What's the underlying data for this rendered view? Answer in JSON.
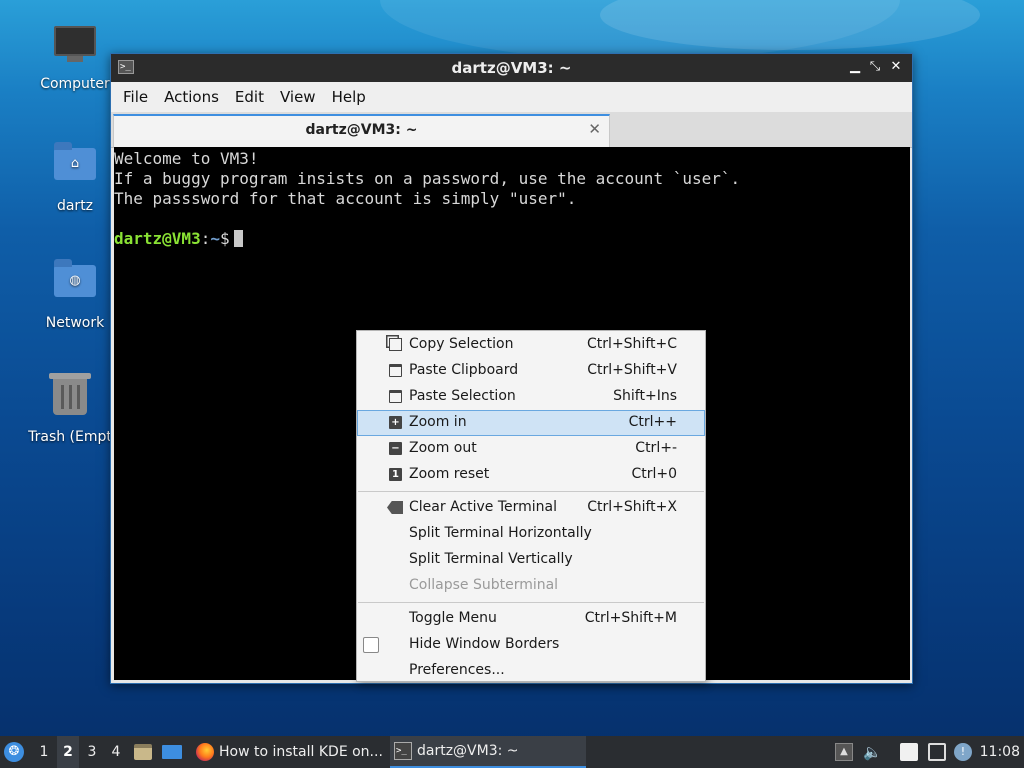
{
  "desktop": {
    "icons": [
      {
        "label": "Computer",
        "icon": "computer-icon"
      },
      {
        "label": "dartz",
        "icon": "home-folder-icon"
      },
      {
        "label": "Network",
        "icon": "network-folder-icon"
      },
      {
        "label": "Trash (Empt",
        "icon": "trash-icon"
      }
    ]
  },
  "window": {
    "title": "dartz@VM3: ~",
    "menu": [
      "File",
      "Actions",
      "Edit",
      "View",
      "Help"
    ],
    "tab_label": "dartz@VM3: ~",
    "terminal": {
      "lines": [
        "Welcome to VM3!",
        "If a buggy program insists on a password, use the account `user`.",
        "The passsword for that account is simply \"user\"."
      ],
      "prompt_user": "dartz@VM3",
      "prompt_colon": ":",
      "prompt_path": "~",
      "prompt_symbol": "$"
    }
  },
  "context_menu": {
    "items": [
      {
        "label": "Copy Selection",
        "shortcut": "Ctrl+Shift+C",
        "icon": "copy-icon"
      },
      {
        "label": "Paste Clipboard",
        "shortcut": "Ctrl+Shift+V",
        "icon": "paste-icon"
      },
      {
        "label": "Paste Selection",
        "shortcut": "Shift+Ins",
        "icon": "paste-icon"
      },
      {
        "label": "Zoom in",
        "shortcut": "Ctrl++",
        "icon": "zoom-in-icon",
        "highlighted": true
      },
      {
        "label": "Zoom out",
        "shortcut": "Ctrl+-",
        "icon": "zoom-out-icon"
      },
      {
        "label": "Zoom reset",
        "shortcut": "Ctrl+0",
        "icon": "zoom-reset-icon"
      },
      {
        "label": "Clear Active Terminal",
        "shortcut": "Ctrl+Shift+X",
        "icon": "clear-icon"
      },
      {
        "label": "Split Terminal Horizontally",
        "shortcut": ""
      },
      {
        "label": "Split Terminal Vertically",
        "shortcut": ""
      },
      {
        "label": "Collapse Subterminal",
        "shortcut": "",
        "disabled": true
      },
      {
        "label": "Toggle Menu",
        "shortcut": "Ctrl+Shift+M"
      },
      {
        "label": "Hide Window Borders",
        "shortcut": "",
        "checkbox": true,
        "checked": false
      },
      {
        "label": "Preferences...",
        "shortcut": ""
      }
    ]
  },
  "taskbar": {
    "workspaces": [
      "1",
      "2",
      "3",
      "4"
    ],
    "current_workspace": "2",
    "tasks": [
      {
        "label": "How to install KDE on...",
        "icon": "firefox-icon"
      },
      {
        "label": "dartz@VM3: ~",
        "icon": "terminal-icon",
        "active": true
      }
    ],
    "clock": "11:08"
  },
  "colors": {
    "accent": "#3d8ee0",
    "prompt_user": "#8ae234",
    "prompt_path": "#729fcf",
    "highlight": "#cfe3f5"
  }
}
